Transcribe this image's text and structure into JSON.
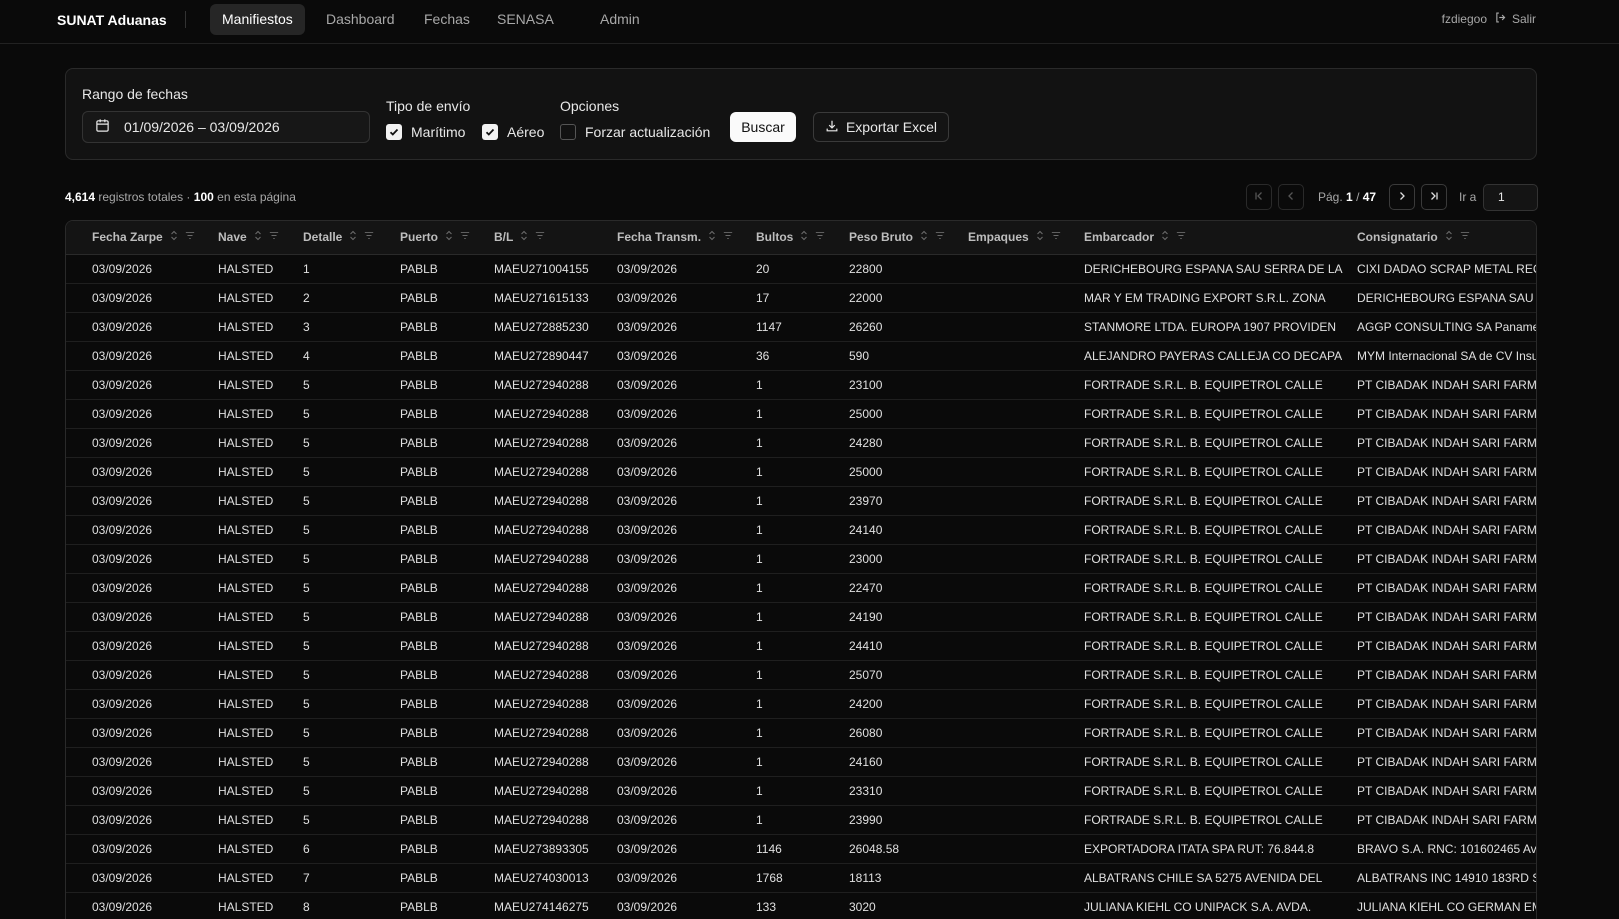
{
  "nav": {
    "brand": "SUNAT Aduanas",
    "items": [
      "Manifiestos",
      "Dashboard",
      "Fechas",
      "SENASA",
      "Admin"
    ],
    "user": "fzdiegoo",
    "logout_label": "Salir"
  },
  "filters": {
    "date_label": "Rango de fechas",
    "date_value": "01/09/2026 – 03/09/2026",
    "tipo_label": "Tipo de envío",
    "maritimo_label": "Marítimo",
    "maritimo_checked": true,
    "aereo_label": "Aéreo",
    "aereo_checked": true,
    "opciones_label": "Opciones",
    "forzar_label": "Forzar actualización",
    "forzar_checked": false,
    "buscar_label": "Buscar",
    "export_label": "Exportar Excel"
  },
  "summary": {
    "total": "4,614",
    "total_suffix": "registros totales ·",
    "page_count": "100",
    "page_suffix": "en esta página"
  },
  "pagination": {
    "page_prefix": "Pág.",
    "current": "1",
    "sep": "/",
    "total": "47",
    "goto_label": "Ir a",
    "goto_value": "1"
  },
  "table": {
    "columns": [
      "Fecha Zarpe",
      "Nave",
      "Detalle",
      "Puerto",
      "B/L",
      "Fecha Transm.",
      "Bultos",
      "Peso Bruto",
      "Empaques",
      "Embarcador",
      "Consignatario"
    ],
    "rows": [
      [
        "03/09/2026",
        "HALSTED",
        "1",
        "PABLB",
        "MAEU271004155",
        "03/09/2026",
        "20",
        "22800",
        "",
        "DERICHEBOURG ESPANA SAU SERRA DE LA",
        "CIXI DADAO SCRAP METAL RECY"
      ],
      [
        "03/09/2026",
        "HALSTED",
        "2",
        "PABLB",
        "MAEU271615133",
        "03/09/2026",
        "17",
        "22000",
        "",
        "MAR Y EM TRADING EXPORT S.R.L. ZONA",
        "DERICHEBOURG ESPANA SAU S"
      ],
      [
        "03/09/2026",
        "HALSTED",
        "3",
        "PABLB",
        "MAEU272885230",
        "03/09/2026",
        "1147",
        "26260",
        "",
        "STANMORE LTDA. EUROPA 1907 PROVIDEN",
        "AGGP CONSULTING SA Panamer"
      ],
      [
        "03/09/2026",
        "HALSTED",
        "4",
        "PABLB",
        "MAEU272890447",
        "03/09/2026",
        "36",
        "590",
        "",
        "ALEJANDRO PAYERAS CALLEJA CO DECAPA",
        "MYM Internacional SA de CV Insu"
      ],
      [
        "03/09/2026",
        "HALSTED",
        "5",
        "PABLB",
        "MAEU272940288",
        "03/09/2026",
        "1",
        "23100",
        "",
        "FORTRADE S.R.L. B. EQUIPETROL CALLE",
        "PT CIBADAK INDAH SARI FARM J"
      ],
      [
        "03/09/2026",
        "HALSTED",
        "5",
        "PABLB",
        "MAEU272940288",
        "03/09/2026",
        "1",
        "25000",
        "",
        "FORTRADE S.R.L. B. EQUIPETROL CALLE",
        "PT CIBADAK INDAH SARI FARM J"
      ],
      [
        "03/09/2026",
        "HALSTED",
        "5",
        "PABLB",
        "MAEU272940288",
        "03/09/2026",
        "1",
        "24280",
        "",
        "FORTRADE S.R.L. B. EQUIPETROL CALLE",
        "PT CIBADAK INDAH SARI FARM J"
      ],
      [
        "03/09/2026",
        "HALSTED",
        "5",
        "PABLB",
        "MAEU272940288",
        "03/09/2026",
        "1",
        "25000",
        "",
        "FORTRADE S.R.L. B. EQUIPETROL CALLE",
        "PT CIBADAK INDAH SARI FARM J"
      ],
      [
        "03/09/2026",
        "HALSTED",
        "5",
        "PABLB",
        "MAEU272940288",
        "03/09/2026",
        "1",
        "23970",
        "",
        "FORTRADE S.R.L. B. EQUIPETROL CALLE",
        "PT CIBADAK INDAH SARI FARM J"
      ],
      [
        "03/09/2026",
        "HALSTED",
        "5",
        "PABLB",
        "MAEU272940288",
        "03/09/2026",
        "1",
        "24140",
        "",
        "FORTRADE S.R.L. B. EQUIPETROL CALLE",
        "PT CIBADAK INDAH SARI FARM J"
      ],
      [
        "03/09/2026",
        "HALSTED",
        "5",
        "PABLB",
        "MAEU272940288",
        "03/09/2026",
        "1",
        "23000",
        "",
        "FORTRADE S.R.L. B. EQUIPETROL CALLE",
        "PT CIBADAK INDAH SARI FARM J"
      ],
      [
        "03/09/2026",
        "HALSTED",
        "5",
        "PABLB",
        "MAEU272940288",
        "03/09/2026",
        "1",
        "22470",
        "",
        "FORTRADE S.R.L. B. EQUIPETROL CALLE",
        "PT CIBADAK INDAH SARI FARM J"
      ],
      [
        "03/09/2026",
        "HALSTED",
        "5",
        "PABLB",
        "MAEU272940288",
        "03/09/2026",
        "1",
        "24190",
        "",
        "FORTRADE S.R.L. B. EQUIPETROL CALLE",
        "PT CIBADAK INDAH SARI FARM J"
      ],
      [
        "03/09/2026",
        "HALSTED",
        "5",
        "PABLB",
        "MAEU272940288",
        "03/09/2026",
        "1",
        "24410",
        "",
        "FORTRADE S.R.L. B. EQUIPETROL CALLE",
        "PT CIBADAK INDAH SARI FARM J"
      ],
      [
        "03/09/2026",
        "HALSTED",
        "5",
        "PABLB",
        "MAEU272940288",
        "03/09/2026",
        "1",
        "25070",
        "",
        "FORTRADE S.R.L. B. EQUIPETROL CALLE",
        "PT CIBADAK INDAH SARI FARM J"
      ],
      [
        "03/09/2026",
        "HALSTED",
        "5",
        "PABLB",
        "MAEU272940288",
        "03/09/2026",
        "1",
        "24200",
        "",
        "FORTRADE S.R.L. B. EQUIPETROL CALLE",
        "PT CIBADAK INDAH SARI FARM J"
      ],
      [
        "03/09/2026",
        "HALSTED",
        "5",
        "PABLB",
        "MAEU272940288",
        "03/09/2026",
        "1",
        "26080",
        "",
        "FORTRADE S.R.L. B. EQUIPETROL CALLE",
        "PT CIBADAK INDAH SARI FARM J"
      ],
      [
        "03/09/2026",
        "HALSTED",
        "5",
        "PABLB",
        "MAEU272940288",
        "03/09/2026",
        "1",
        "24160",
        "",
        "FORTRADE S.R.L. B. EQUIPETROL CALLE",
        "PT CIBADAK INDAH SARI FARM J"
      ],
      [
        "03/09/2026",
        "HALSTED",
        "5",
        "PABLB",
        "MAEU272940288",
        "03/09/2026",
        "1",
        "23310",
        "",
        "FORTRADE S.R.L. B. EQUIPETROL CALLE",
        "PT CIBADAK INDAH SARI FARM J"
      ],
      [
        "03/09/2026",
        "HALSTED",
        "5",
        "PABLB",
        "MAEU272940288",
        "03/09/2026",
        "1",
        "23990",
        "",
        "FORTRADE S.R.L. B. EQUIPETROL CALLE",
        "PT CIBADAK INDAH SARI FARM J"
      ],
      [
        "03/09/2026",
        "HALSTED",
        "6",
        "PABLB",
        "MAEU273893305",
        "03/09/2026",
        "1146",
        "26048.58",
        "",
        "EXPORTADORA ITATA SPA RUT: 76.844.8",
        "BRAVO S.A. RNC: 101602465 Av."
      ],
      [
        "03/09/2026",
        "HALSTED",
        "7",
        "PABLB",
        "MAEU274030013",
        "03/09/2026",
        "1768",
        "18113",
        "",
        "ALBATRANS CHILE SA 5275 AVENIDA DEL",
        "ALBATRANS INC 14910 183RD ST"
      ],
      [
        "03/09/2026",
        "HALSTED",
        "8",
        "PABLB",
        "MAEU274146275",
        "03/09/2026",
        "133",
        "3020",
        "",
        "JULIANA KIEHL CO UNIPACK S.A. AVDA.",
        "JULIANA KIEHL CO GERMAN EM"
      ]
    ]
  }
}
